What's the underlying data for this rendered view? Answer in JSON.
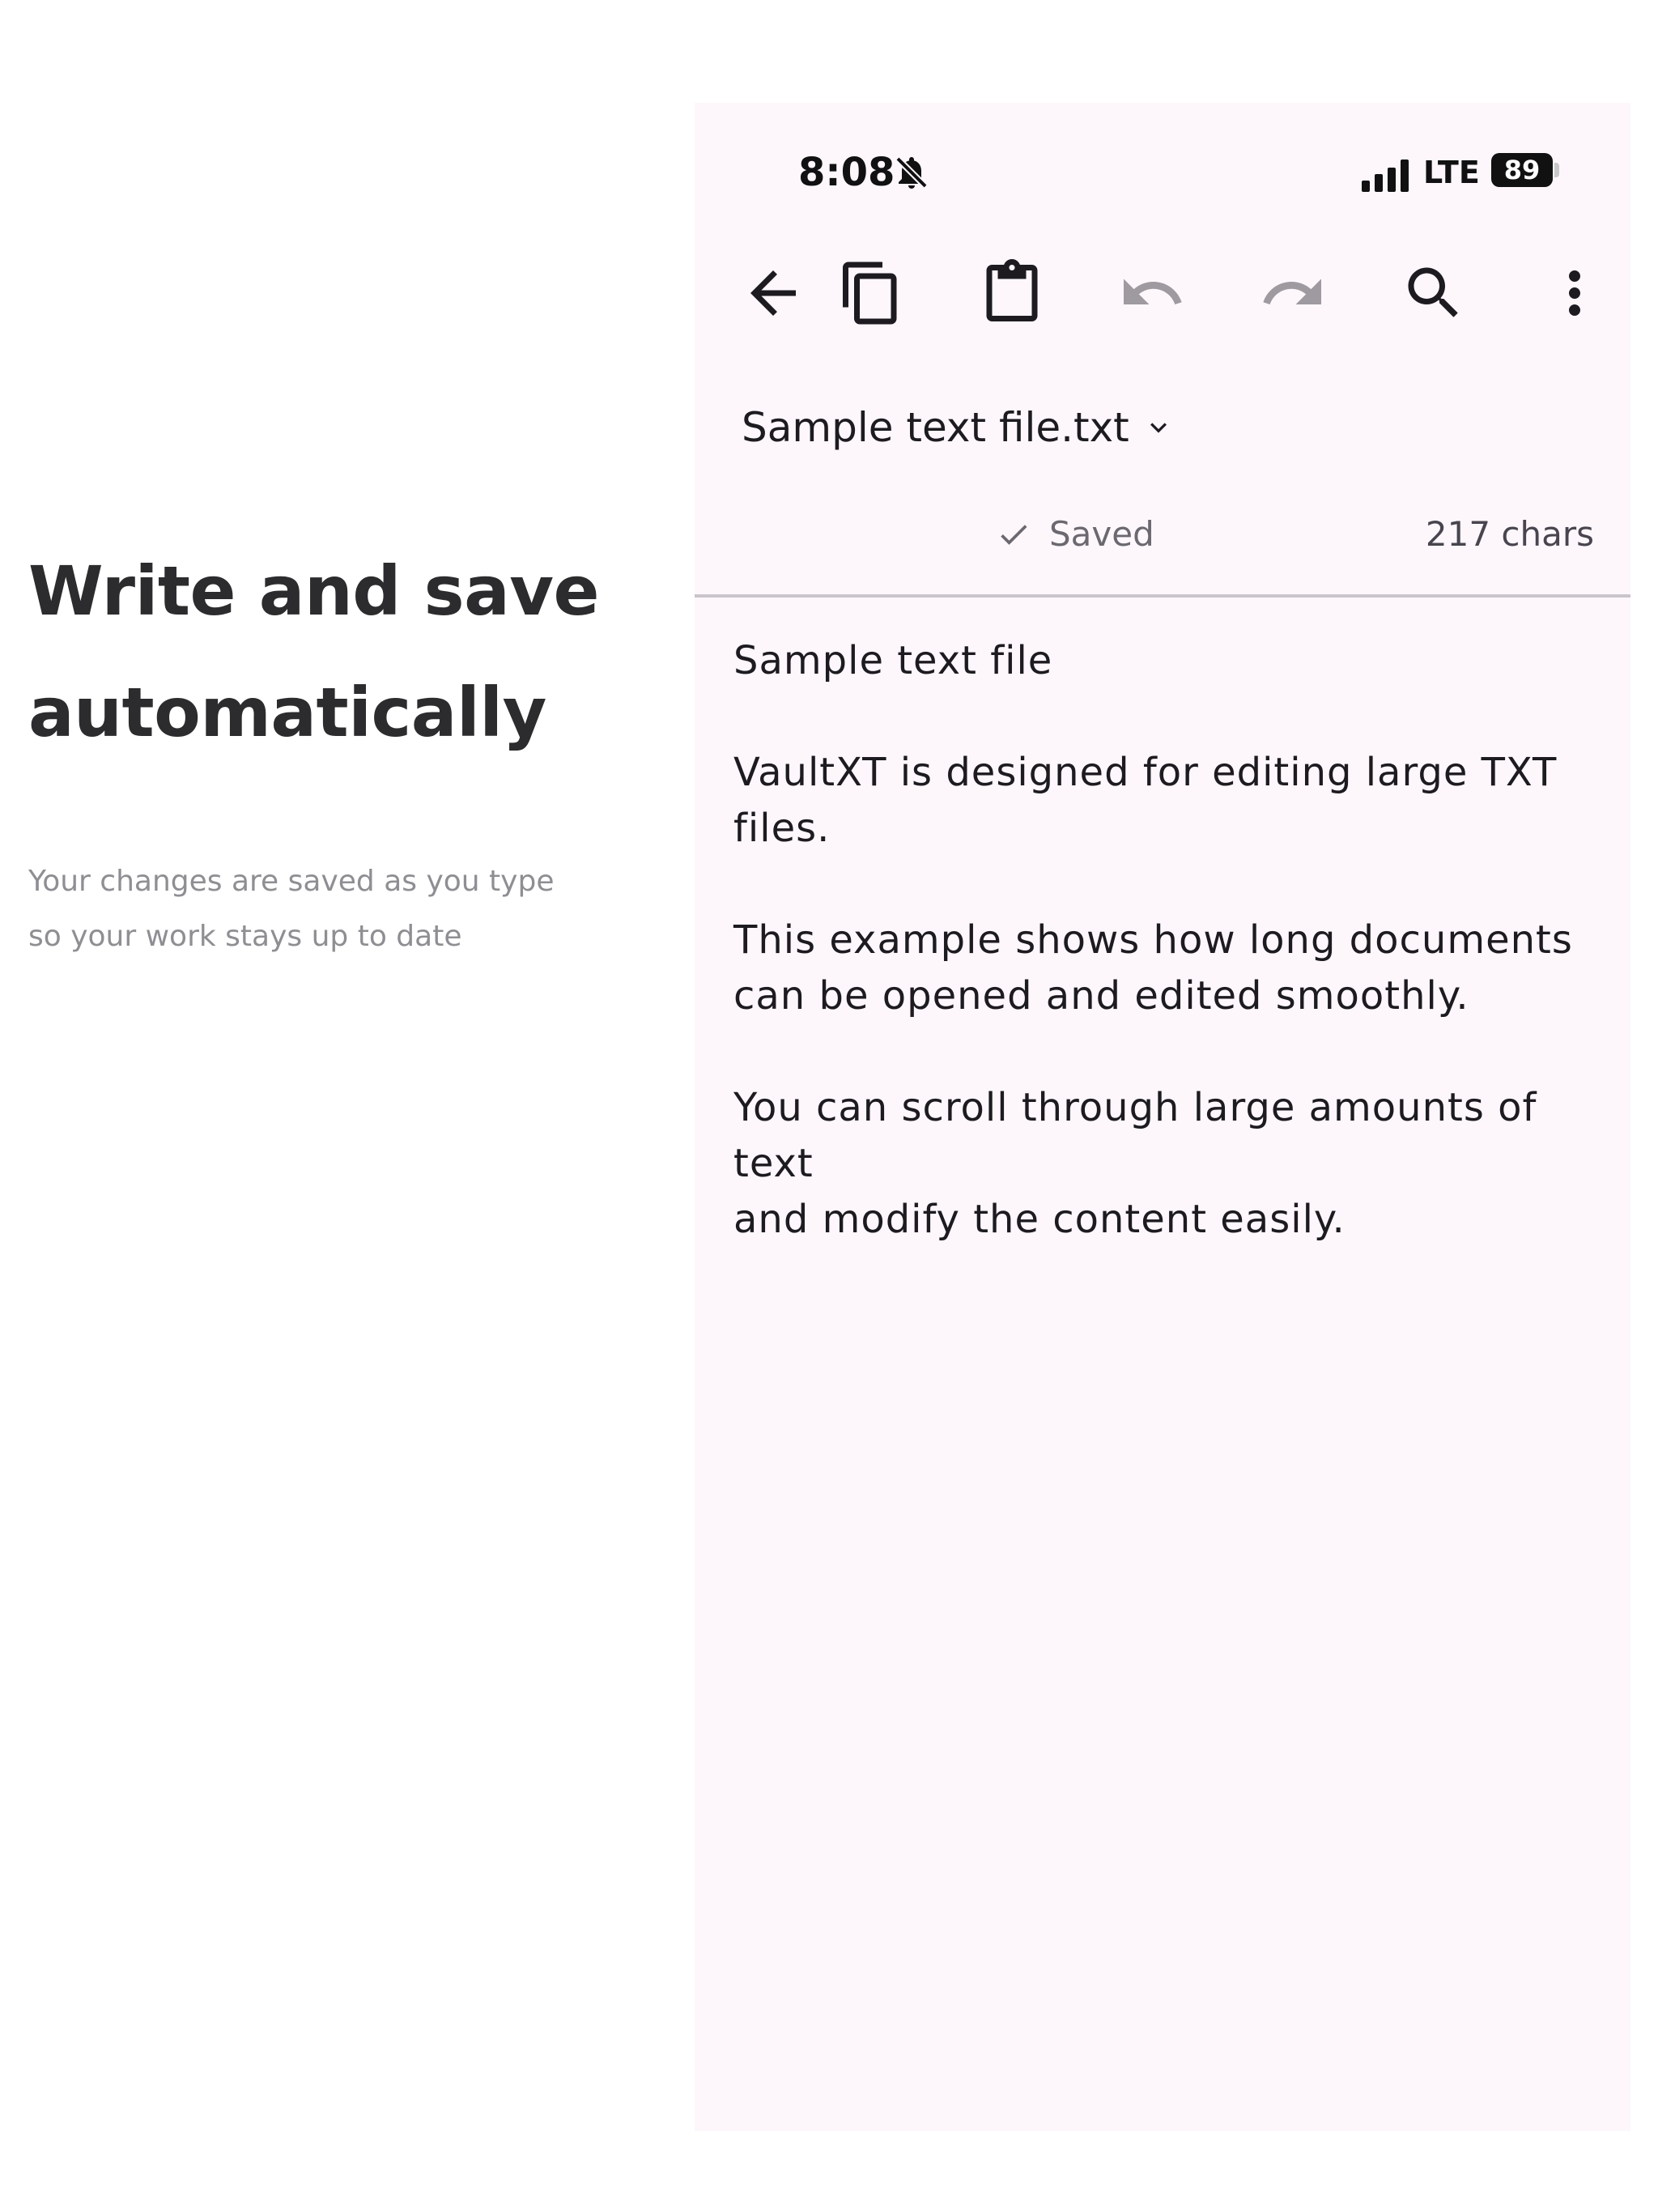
{
  "promo": {
    "title_line1": "Write and save",
    "title_line2": "automatically",
    "subtitle_line1": "Your changes are saved as you type",
    "subtitle_line2": "so your work stays up to date"
  },
  "status_bar": {
    "time": "8:08",
    "network": "LTE",
    "battery": "89"
  },
  "toolbar": {
    "icons": [
      "back-arrow-icon",
      "copy-icon",
      "paste-icon",
      "undo-icon",
      "redo-icon",
      "search-icon",
      "more-vert-icon"
    ]
  },
  "file": {
    "name": "Sample text file.txt",
    "save_status": "Saved",
    "char_count": "217 chars"
  },
  "editor": {
    "content": "Sample text file\n\nVaultXT is designed for editing large TXT files.\n\nThis example shows how long documents can be opened and edited smoothly.\n\nYou can scroll through large amounts of text\nand modify the content easily."
  },
  "colors": {
    "screen_bg": "#fdf7fc",
    "icon_active": "#1d1b20",
    "icon_disabled": "#9e9aa0"
  }
}
